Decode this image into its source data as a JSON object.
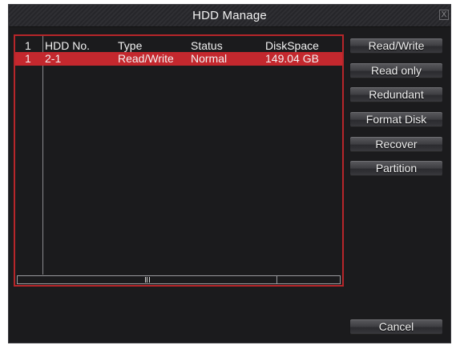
{
  "window": {
    "title": "HDD Manage",
    "close_label": "X"
  },
  "table": {
    "headers": {
      "index": "1",
      "hdd_no": "HDD No.",
      "type": "Type",
      "status": "Status",
      "disk_space": "DiskSpace"
    },
    "rows": [
      {
        "index": "1",
        "hdd_no": "2-1",
        "type": "Read/Write",
        "status": "Normal",
        "disk_space": "149.04 GB"
      }
    ]
  },
  "buttons": {
    "read_write": "Read/Write",
    "read_only": "Read only",
    "redundant": "Redundant",
    "format_disk": "Format Disk",
    "recover": "Recover",
    "partition": "Partition",
    "cancel": "Cancel"
  },
  "colors": {
    "accent": "#c4282e",
    "panel_border": "#b7262a",
    "background": "#1b1b1d"
  }
}
